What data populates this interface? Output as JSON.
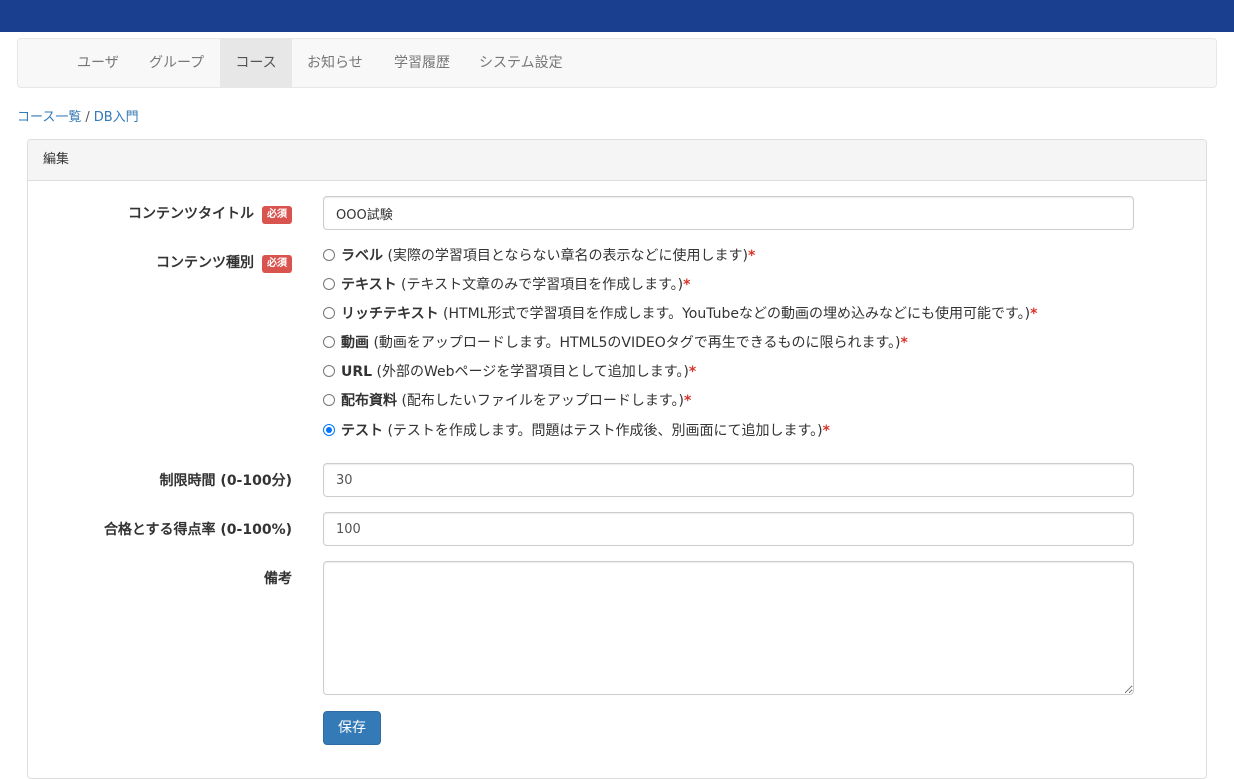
{
  "nav": {
    "items": [
      {
        "label": "ユーザ"
      },
      {
        "label": "グループ"
      },
      {
        "label": "コース",
        "active": true
      },
      {
        "label": "お知らせ"
      },
      {
        "label": "学習履歴"
      },
      {
        "label": "システム設定"
      }
    ]
  },
  "breadcrumb": {
    "parent": "コース一覧",
    "separator": "/",
    "current": "DB入門"
  },
  "panel": {
    "heading": "編集"
  },
  "form": {
    "required_badge": "必須",
    "title": {
      "label": "コンテンツタイトル",
      "value": "OOO試験"
    },
    "content_type": {
      "label": "コンテンツ種別",
      "selected": "テスト",
      "options": [
        {
          "name": "ラベル",
          "desc": " (実際の学習項目とならない章名の表示などに使用します)",
          "mark": "*"
        },
        {
          "name": "テキスト",
          "desc": " (テキスト文章のみで学習項目を作成します。)",
          "mark": "*"
        },
        {
          "name": "リッチテキスト",
          "desc": " (HTML形式で学習項目を作成します。YouTubeなどの動画の埋め込みなどにも使用可能です。)",
          "mark": "*"
        },
        {
          "name": "動画",
          "desc": " (動画をアップロードします。HTML5のVIDEOタグで再生できるものに限られます。)",
          "mark": "*"
        },
        {
          "name": "URL",
          "desc": " (外部のWebページを学習項目として追加します。)",
          "mark": "*"
        },
        {
          "name": "配布資料",
          "desc": " (配布したいファイルをアップロードします。)",
          "mark": "*"
        },
        {
          "name": "テスト",
          "desc": " (テストを作成します。問題はテスト作成後、別画面にて追加します。)",
          "mark": "*"
        }
      ]
    },
    "time_limit": {
      "label": "制限時間 (0-100分)",
      "value": "30"
    },
    "pass_rate": {
      "label": "合格とする得点率 (0-100%)",
      "value": "100"
    },
    "notes": {
      "label": "備考",
      "value": ""
    },
    "save_label": "保存"
  },
  "colors": {
    "topbar": "#1b3f8f",
    "primary": "#337ab7",
    "required": "#d9534f"
  }
}
